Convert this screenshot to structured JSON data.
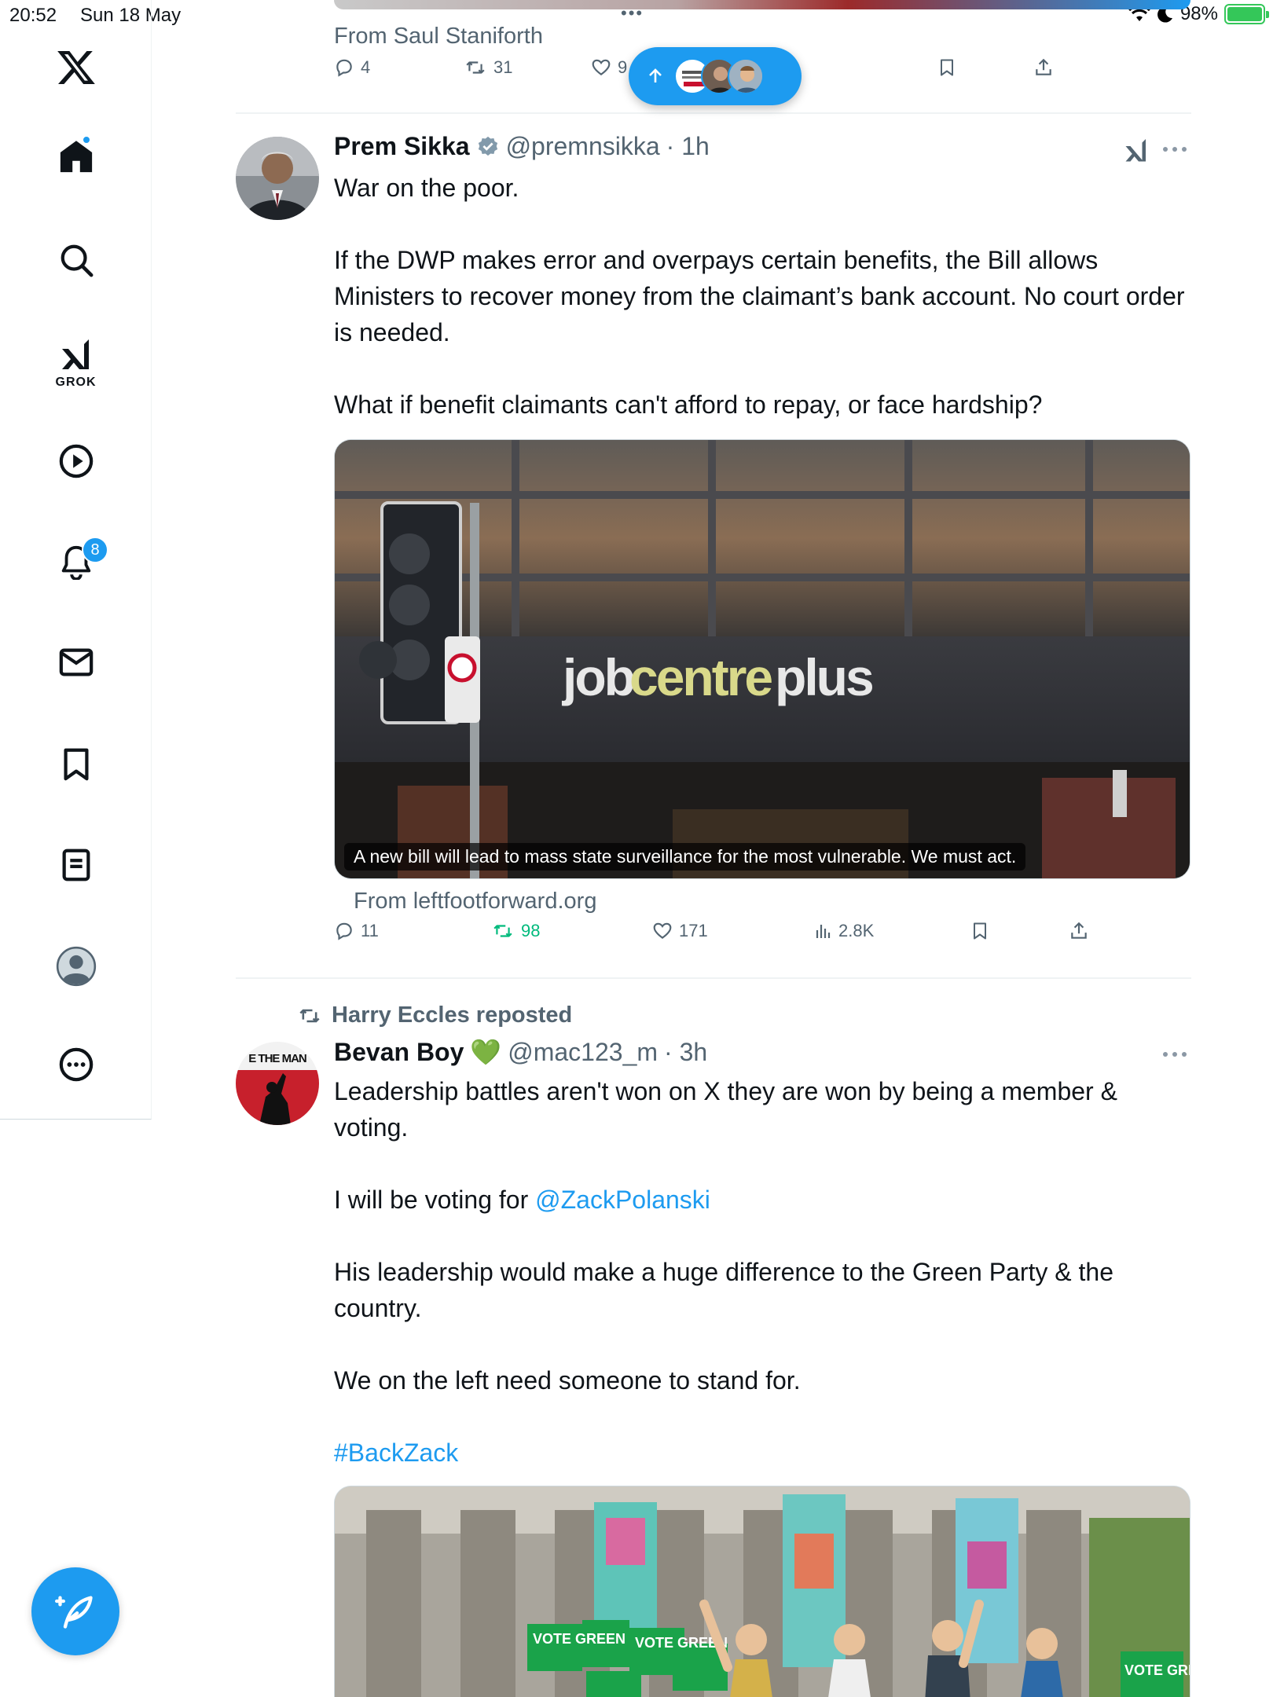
{
  "status_bar": {
    "time": "20:52",
    "date": "Sun 18 May",
    "battery": "98%"
  },
  "sidebar": {
    "items": [
      {
        "name": "home",
        "icon": "home-icon"
      },
      {
        "name": "explore",
        "icon": "search-icon"
      },
      {
        "name": "grok",
        "icon": "grok-icon",
        "label": "GROK"
      },
      {
        "name": "videos",
        "icon": "play-icon"
      },
      {
        "name": "notifications",
        "icon": "bell-icon",
        "badge": "8"
      },
      {
        "name": "messages",
        "icon": "mail-icon"
      },
      {
        "name": "bookmarks",
        "icon": "bookmark-icon"
      },
      {
        "name": "articles",
        "icon": "article-icon"
      },
      {
        "name": "profile",
        "icon": "profile-icon"
      },
      {
        "name": "more",
        "icon": "more-icon"
      }
    ]
  },
  "new_posts_pill": {
    "icon": "arrow-up-icon"
  },
  "top_post": {
    "source": "From Saul Staniforth",
    "replies": "4",
    "reposts": "31",
    "likes": "9"
  },
  "post1": {
    "name": "Prem Sikka",
    "handle": "@premnsikka",
    "time": "· 1h",
    "verified": true,
    "paragraphs": [
      "War on the poor.",
      "If the DWP makes error and overpays certain benefits, the Bill allows Ministers to recover money from the claimant’s bank account.  No court order is needed.",
      "What if benefit claimants can't afford to repay, or face hardship?"
    ],
    "card": {
      "sign_text_left": "job",
      "sign_text_mid": "centre",
      "sign_text_right": "plus",
      "caption": "A new bill will lead to mass state surveillance for the most vulnerable. We must act.",
      "source": "From leftfootforward.org"
    },
    "replies": "11",
    "reposts": "98",
    "likes": "171",
    "views": "2.8K"
  },
  "post2": {
    "reposted_by": "Harry Eccles reposted",
    "avatar_text": "E THE MAN",
    "name": "Bevan Boy",
    "emoji": "💚",
    "handle": "@mac123_m",
    "time": "· 3h",
    "line1": "Leadership battles aren't won on X they are won by being a member & voting.",
    "line2_prefix": "I will be voting for ",
    "mention": "@ZackPolanski",
    "line3": "His leadership would make a huge difference to the Green Party & the country.",
    "line4": "We on the left need someone to stand for.",
    "hashtag": "#BackZack",
    "placard": "VOTE GREEN"
  },
  "colors": {
    "accent": "#1d9bf0",
    "text": "#0f1419",
    "muted": "#536471",
    "repost_active": "#00ba7c",
    "divider": "#eff3f4"
  }
}
